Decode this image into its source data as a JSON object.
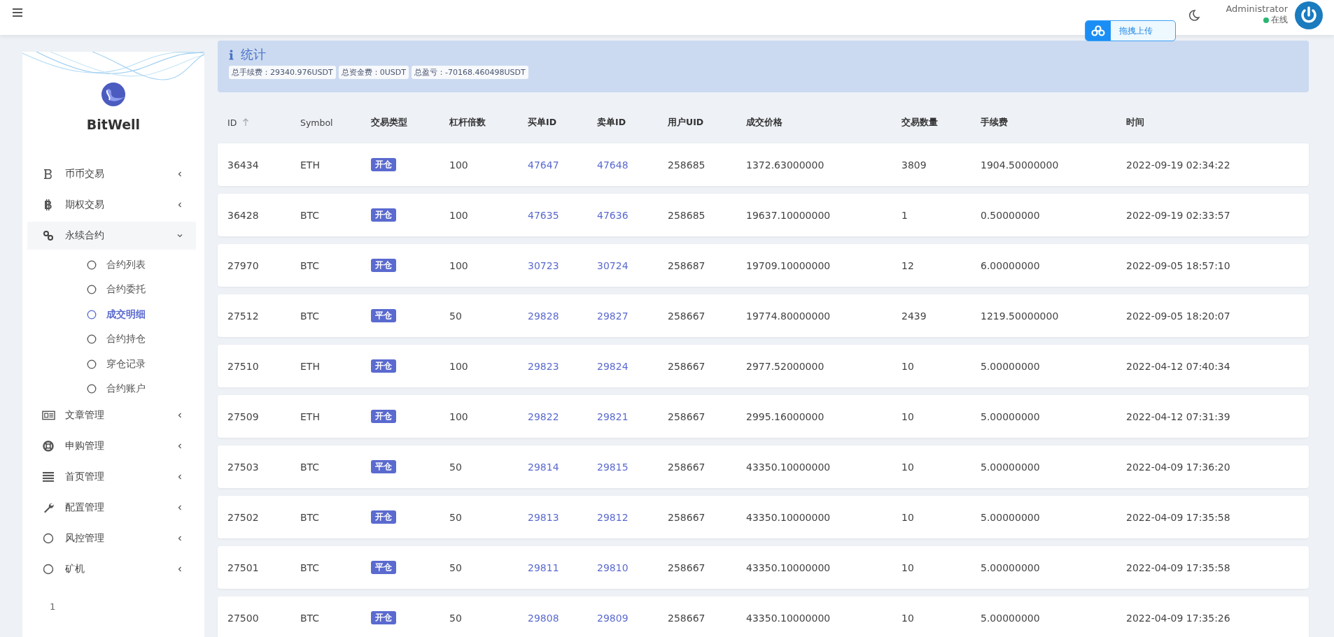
{
  "header": {
    "user_name": "Administrator",
    "status": "在线",
    "upload_button": "拖拽上传"
  },
  "sidebar": {
    "brand": "BitWell",
    "items": [
      {
        "label": "币币交易",
        "expanded": false
      },
      {
        "label": "期权交易",
        "expanded": false
      },
      {
        "label": "永续合约",
        "expanded": true,
        "children": [
          {
            "label": "合约列表",
            "selected": false
          },
          {
            "label": "合约委托",
            "selected": false
          },
          {
            "label": "成交明细",
            "selected": true
          },
          {
            "label": "合约持仓",
            "selected": false
          },
          {
            "label": "穿仓记录",
            "selected": false
          },
          {
            "label": "合约账户",
            "selected": false
          }
        ]
      },
      {
        "label": "文章管理",
        "expanded": false
      },
      {
        "label": "申购管理",
        "expanded": false
      },
      {
        "label": "首页管理",
        "expanded": false
      },
      {
        "label": "配置管理",
        "expanded": false
      },
      {
        "label": "风控管理",
        "expanded": false
      },
      {
        "label": "矿机",
        "expanded": false
      }
    ],
    "page_number": "1"
  },
  "stats": {
    "title": "统计",
    "tags": [
      "总手续费：29340.976USDT",
      "总资金费：0USDT",
      "总盈亏：-70168.460498USDT"
    ]
  },
  "table": {
    "columns": [
      {
        "label": "ID",
        "sorted": true
      },
      {
        "label": "Symbol",
        "sorted": false
      },
      {
        "label": "交易类型",
        "sorted": false
      },
      {
        "label": "杠杆倍数",
        "sorted": false
      },
      {
        "label": "买单ID",
        "sorted": false
      },
      {
        "label": "卖单ID",
        "sorted": false
      },
      {
        "label": "用户UID",
        "sorted": false
      },
      {
        "label": "成交价格",
        "sorted": false
      },
      {
        "label": "交易数量",
        "sorted": false
      },
      {
        "label": "手续费",
        "sorted": false
      },
      {
        "label": "时间",
        "sorted": false
      }
    ],
    "rows": [
      {
        "id": "36434",
        "symbol": "ETH",
        "type": "开仓",
        "leverage": "100",
        "buy_id": "47647",
        "sell_id": "47648",
        "uid": "258685",
        "price": "1372.63000000",
        "amount": "3809",
        "fee": "1904.50000000",
        "time": "2022-09-19 02:34:22"
      },
      {
        "id": "36428",
        "symbol": "BTC",
        "type": "开仓",
        "leverage": "100",
        "buy_id": "47635",
        "sell_id": "47636",
        "uid": "258685",
        "price": "19637.10000000",
        "amount": "1",
        "fee": "0.50000000",
        "time": "2022-09-19 02:33:57"
      },
      {
        "id": "27970",
        "symbol": "BTC",
        "type": "开仓",
        "leverage": "100",
        "buy_id": "30723",
        "sell_id": "30724",
        "uid": "258687",
        "price": "19709.10000000",
        "amount": "12",
        "fee": "6.00000000",
        "time": "2022-09-05 18:57:10"
      },
      {
        "id": "27512",
        "symbol": "BTC",
        "type": "平仓",
        "leverage": "50",
        "buy_id": "29828",
        "sell_id": "29827",
        "uid": "258667",
        "price": "19774.80000000",
        "amount": "2439",
        "fee": "1219.50000000",
        "time": "2022-09-05 18:20:07"
      },
      {
        "id": "27510",
        "symbol": "ETH",
        "type": "开仓",
        "leverage": "100",
        "buy_id": "29823",
        "sell_id": "29824",
        "uid": "258667",
        "price": "2977.52000000",
        "amount": "10",
        "fee": "5.00000000",
        "time": "2022-04-12 07:40:34"
      },
      {
        "id": "27509",
        "symbol": "ETH",
        "type": "开仓",
        "leverage": "100",
        "buy_id": "29822",
        "sell_id": "29821",
        "uid": "258667",
        "price": "2995.16000000",
        "amount": "10",
        "fee": "5.00000000",
        "time": "2022-04-12 07:31:39"
      },
      {
        "id": "27503",
        "symbol": "BTC",
        "type": "平仓",
        "leverage": "50",
        "buy_id": "29814",
        "sell_id": "29815",
        "uid": "258667",
        "price": "43350.10000000",
        "amount": "10",
        "fee": "5.00000000",
        "time": "2022-04-09 17:36:20"
      },
      {
        "id": "27502",
        "symbol": "BTC",
        "type": "开仓",
        "leverage": "50",
        "buy_id": "29813",
        "sell_id": "29812",
        "uid": "258667",
        "price": "43350.10000000",
        "amount": "10",
        "fee": "5.00000000",
        "time": "2022-04-09 17:35:58"
      },
      {
        "id": "27501",
        "symbol": "BTC",
        "type": "平仓",
        "leverage": "50",
        "buy_id": "29811",
        "sell_id": "29810",
        "uid": "258667",
        "price": "43350.10000000",
        "amount": "10",
        "fee": "5.00000000",
        "time": "2022-04-09 17:35:58"
      },
      {
        "id": "27500",
        "symbol": "BTC",
        "type": "开仓",
        "leverage": "50",
        "buy_id": "29808",
        "sell_id": "29809",
        "uid": "258667",
        "price": "43350.10000000",
        "amount": "10",
        "fee": "5.00000000",
        "time": "2022-04-09 17:35:26"
      }
    ]
  }
}
